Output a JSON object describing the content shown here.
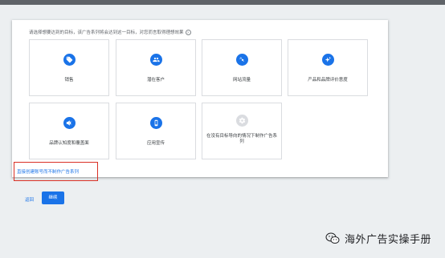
{
  "instruction": "请选择想要达到的目标，该广告系列将会达到这一目标，对您而言取得理想效果",
  "help_icon": "?",
  "goals": [
    {
      "label": "销售",
      "icon": "tag-icon"
    },
    {
      "label": "潜在客户",
      "icon": "people-icon"
    },
    {
      "label": "网站流量",
      "icon": "click-icon"
    },
    {
      "label": "产品和品牌评价意度",
      "icon": "sparkle-icon"
    },
    {
      "label": "品牌认知度和覆盖面",
      "icon": "megaphone-icon"
    },
    {
      "label": "应用宣传",
      "icon": "phone-icon"
    },
    {
      "label": "在没有目标导向的情况下制作广告系列",
      "icon": "gear-icon"
    }
  ],
  "no_goal_link": "直接创建账号而不制作广告系列",
  "back_label": "返回",
  "continue_label": "继续",
  "watermark": "海外广告实操手册",
  "colors": {
    "accent": "#1a73e8",
    "highlight": "#d93025"
  }
}
